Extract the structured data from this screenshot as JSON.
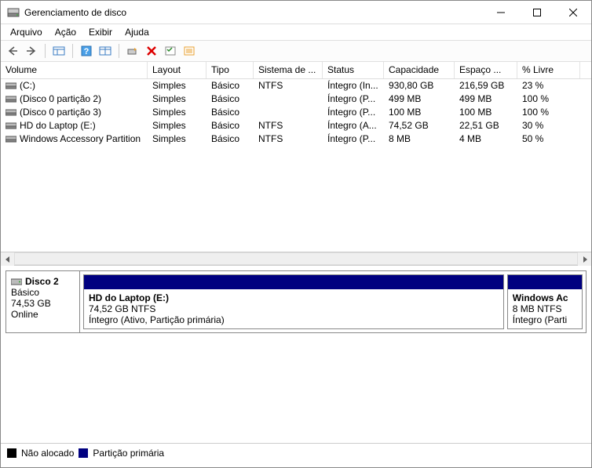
{
  "title": "Gerenciamento de disco",
  "menu": {
    "file": "Arquivo",
    "action": "Ação",
    "view": "Exibir",
    "help": "Ajuda"
  },
  "columns": [
    "Volume",
    "Layout",
    "Tipo",
    "Sistema de ...",
    "Status",
    "Capacidade",
    "Espaço ...",
    "% Livre"
  ],
  "volumes": [
    {
      "name": "(C:)",
      "layout": "Simples",
      "type": "Básico",
      "fs": "NTFS",
      "status": "Íntegro (In...",
      "capacity": "930,80 GB",
      "free": "216,59 GB",
      "pct": "23 %"
    },
    {
      "name": "(Disco 0 partição 2)",
      "layout": "Simples",
      "type": "Básico",
      "fs": "",
      "status": "Íntegro (P...",
      "capacity": "499 MB",
      "free": "499 MB",
      "pct": "100 %"
    },
    {
      "name": "(Disco 0 partição 3)",
      "layout": "Simples",
      "type": "Básico",
      "fs": "",
      "status": "Íntegro (P...",
      "capacity": "100 MB",
      "free": "100 MB",
      "pct": "100 %"
    },
    {
      "name": "HD do Laptop (E:)",
      "layout": "Simples",
      "type": "Básico",
      "fs": "NTFS",
      "status": "Íntegro (A...",
      "capacity": "74,52 GB",
      "free": "22,51 GB",
      "pct": "30 %"
    },
    {
      "name": "Windows Accessory Partition",
      "layout": "Simples",
      "type": "Básico",
      "fs": "NTFS",
      "status": "Íntegro (P...",
      "capacity": "8 MB",
      "free": "4 MB",
      "pct": "50 %"
    }
  ],
  "disk": {
    "label": "Disco 2",
    "type": "Básico",
    "size": "74,53 GB",
    "status": "Online",
    "partitions": [
      {
        "name": "HD do Laptop  (E:)",
        "line2": "74,52 GB NTFS",
        "line3": "Íntegro (Ativo, Partição primária)",
        "grow": 85
      },
      {
        "name": "Windows Ac",
        "line2": "8 MB NTFS",
        "line3": "Íntegro (Parti",
        "grow": 15
      }
    ]
  },
  "legend": {
    "unallocated": "Não alocado",
    "primary": "Partição primária"
  },
  "colors": {
    "primary": "#000080",
    "unallocated": "#000000"
  }
}
